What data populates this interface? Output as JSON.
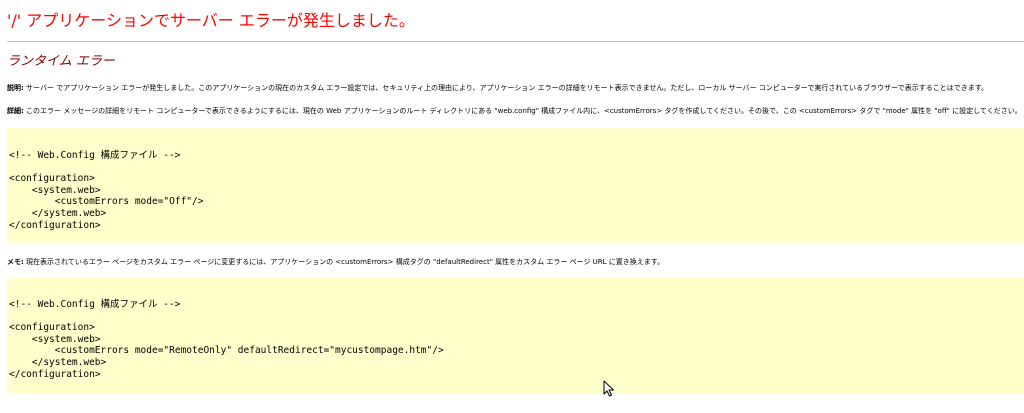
{
  "page": {
    "title": "'/' アプリケーションでサーバー エラーが発生しました。",
    "subtitle": "ランタイム エラー"
  },
  "description": {
    "label": "説明:",
    "text": " サーバー でアプリケーション エラーが発生しました。このアプリケーションの現在のカスタム エラー設定では、セキュリティ上の理由により、アプリケーション エラーの詳細をリモート表示できません。ただし、ローカル サーバー コンピューターで実行されているブラウザーで表示することはできます。"
  },
  "details": {
    "label": "詳細:",
    "text": " このエラー メッセージの詳細をリモート コンピューターで表示できるようにするには、現在の Web アプリケーションのルート ディレクトリにある \"web.config\" 構成ファイル内に、<customErrors> タグを作成してください。その後で、この <customErrors> タグで \"mode\" 属性を \"off\" に設定してください。"
  },
  "code_block_1": {
    "text": "<!-- Web.Config 構成ファイル -->\n\n<configuration>\n    <system.web>\n        <customErrors mode=\"Off\"/>\n    </system.web>\n</configuration>"
  },
  "note": {
    "label": "メモ:",
    "text": " 現在表示されているエラー ページをカスタム エラー ページに変更するには、アプリケーションの <customErrors> 構成タグの \"defaultRedirect\" 属性をカスタム エラー ページ URL に置き換えます。"
  },
  "code_block_2": {
    "text": "<!-- Web.Config 構成ファイル -->\n\n<configuration>\n    <system.web>\n        <customErrors mode=\"RemoteOnly\" defaultRedirect=\"mycustompage.htm\"/>\n    </system.web>\n</configuration>"
  },
  "colors": {
    "title": "#ff0000",
    "subtitle": "#800000",
    "code_background": "#ffffcc",
    "rule": "#c0c0c0"
  },
  "icons": {
    "cursor": "mouse-pointer-icon"
  }
}
